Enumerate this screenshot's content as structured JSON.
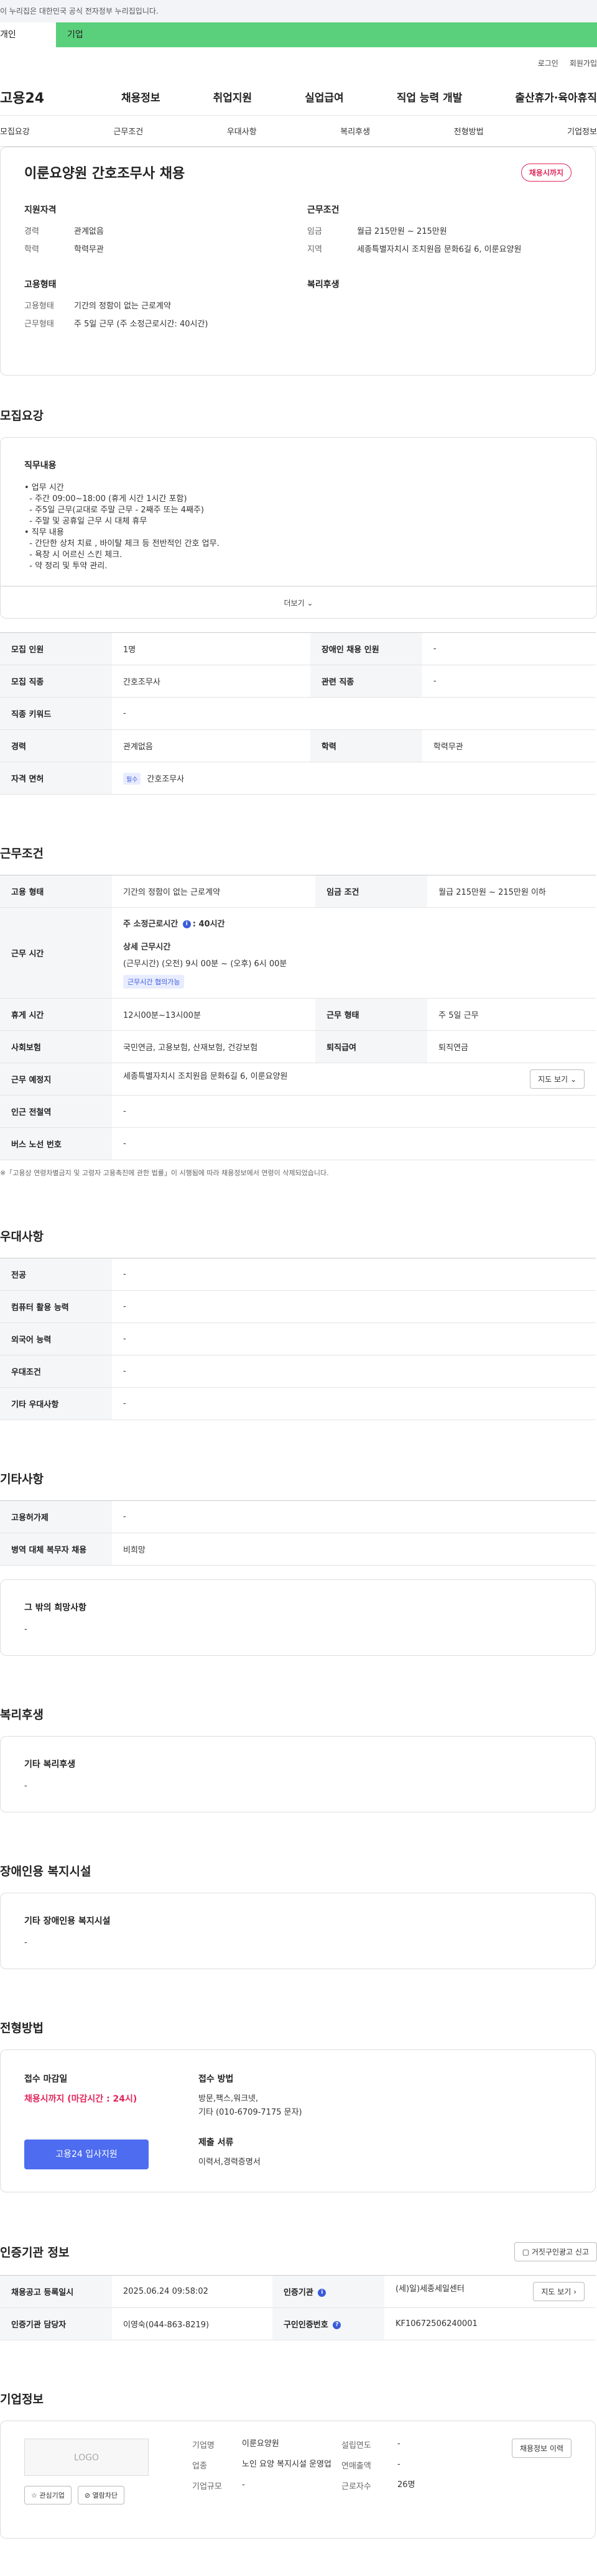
{
  "gov_banner": "이 누리집은 대한민국 공식 전자정부 누리집입니다.",
  "type_tabs": [
    "개인",
    "기업"
  ],
  "util": [
    "로그인",
    "회원가입"
  ],
  "logo": "고용24",
  "gnb": [
    "채용정보",
    "취업지원",
    "실업급여",
    "직업 능력 개발",
    "출산휴가·육아휴직"
  ],
  "section_tabs": [
    "모집요강",
    "근무조건",
    "우대사항",
    "복리후생",
    "전형방법",
    "기업정보"
  ],
  "summary": {
    "title": "이룬요양원 간호조무사 채용",
    "status": "채용시까지",
    "qual_heading": "지원자격",
    "career_key": "경력",
    "career_val": "관계없음",
    "edu_key": "학력",
    "edu_val": "학력무관",
    "cond_heading": "근무조건",
    "wage_key": "임금",
    "wage_val": "월급 215만원 ~ 215만원",
    "region_key": "지역",
    "region_val": "세종특별자치시 조치원읍 문화6길 6, 이룬요양원",
    "emp_heading": "고용형태",
    "emptype_key": "고용형태",
    "emptype_val": "기간의 정함이 없는 근로계약",
    "worktype_key": "근무형태",
    "worktype_val": "주 5일 근무 (주 소정근로시간: 40시간)",
    "welfare_heading": "복리후생"
  },
  "recruit": {
    "heading": "모집요강",
    "duty_heading": "직무내용",
    "duty_lines": [
      "• 업무 시간",
      "  - 주간 09:00~18:00 (휴게 시간 1시간 포함)",
      "  - 주5일 근무(교대로 주말 근무 - 2째주 또는 4째주)",
      "  - 주말 및 공휴일 근무 시 대체 휴무",
      "",
      "• 직무 내용",
      "  - 간단한 상처 치료 , 바이탈 체크 등 전반적인 간호 업무.",
      "  - 욕창 시 어르신 스킨 체크.",
      "  - 약 정리 및 투약 관리."
    ],
    "more": "더보기",
    "table": {
      "count_key": "모집 인원",
      "count_val": "1명",
      "disabled_key": "장애인 채용 인원",
      "disabled_val": "-",
      "job_key": "모집 직종",
      "job_val": "간호조무사",
      "related_key": "관련 직종",
      "related_val": "-",
      "keyword_key": "직종 키워드",
      "keyword_val": "-",
      "career_key": "경력",
      "career_val": "관계없음",
      "edu_key": "학력",
      "edu_val": "학력무관",
      "license_key": "자격 면허",
      "license_tag": "필수",
      "license_val": "간호조무사"
    }
  },
  "conditions": {
    "heading": "근무조건",
    "emptype_key": "고용 형태",
    "emptype_val": "기간의 정함이 없는 근로계약",
    "wage_key": "임금 조건",
    "wage_val": "월급 215만원 ~ 215만원 이하",
    "hours_key": "근무 시간",
    "hours_main": "주 소정근로시간",
    "hours_main_val": ": 40시간",
    "hours_detail_label": "상세 근무시간",
    "hours_detail": "(근무시간) (오전) 9시 00분 ~ (오후) 6시 00분",
    "hours_chip": "근무시간 협의가능",
    "break_key": "휴게 시간",
    "break_val": "12시00분~13시00분",
    "form_key": "근무 형태",
    "form_val": "주 5일 근무",
    "insurance_key": "사회보험",
    "insurance_val": "국민연금, 고용보험, 산재보험, 건강보험",
    "severance_key": "퇴직급여",
    "severance_val": "퇴직연금",
    "place_key": "근무 예정지",
    "place_val": "세종특별자치시 조치원읍 문화6길 6, 이룬요양원",
    "map_btn": "지도 보기",
    "subway_key": "인근 전철역",
    "subway_val": "-",
    "bus_key": "버스 노선 번호",
    "bus_val": "-",
    "note": "※「고용상 연령차별금지 및 고령자 고용촉진에 관한 법률」이 시행됨에 따라 채용정보에서 연령이 삭제되었습니다."
  },
  "preference": {
    "heading": "우대사항",
    "rows": [
      {
        "key": "전공",
        "val": "-"
      },
      {
        "key": "컴퓨터 활용 능력",
        "val": "-"
      },
      {
        "key": "외국어 능력",
        "val": "-"
      },
      {
        "key": "우대조건",
        "val": "-"
      },
      {
        "key": "기타 우대사항",
        "val": "-"
      }
    ]
  },
  "other": {
    "heading": "기타사항",
    "support_key": "고용허가제",
    "support_val": "-",
    "military_key": "병역 대체 복무자 채용",
    "military_val": "비희망",
    "wish_heading": "그 밖의 희망사항",
    "wish_val": "-"
  },
  "welfare": {
    "heading": "복리후생",
    "box_heading": "기타 복리후생",
    "box_val": "-"
  },
  "disability": {
    "heading": "장애인용 복지시설",
    "box_heading": "기타 장애인용 복지시설",
    "box_val": "-"
  },
  "selection": {
    "heading": "전형방법",
    "deadline_label": "접수 마감일",
    "deadline_val": "채용시까지 (마감시간 : 24시)",
    "apply_btn": "고용24 입사지원",
    "method_label": "접수 방법",
    "method_val1": "방문,팩스,워크넷,",
    "method_val2": "기타 (010-6709-7175 문자)",
    "docs_label": "제출 서류",
    "docs_val": "이력서,경력증명서"
  },
  "agency": {
    "heading": "인증기관 정보",
    "report_btn": "거짓구인광고 신고",
    "regdate_key": "채용공고 등록일시",
    "regdate_val": "2025.06.24 09:58:02",
    "agency_key": "인증기관",
    "agency_val": "(세)일)세종세일센터",
    "map_btn": "지도 보기",
    "manager_key": "인증기관 담당자",
    "manager_val": "이영숙(044-863-8219)",
    "jobno_key": "구인인증번호",
    "jobno_val": "KF10672506240001"
  },
  "company": {
    "heading": "기업정보",
    "logo_text": "LOGO",
    "fav_btn": "관심기업",
    "block_btn": "열람차단",
    "name_key": "기업명",
    "name_val": "이룬요양원",
    "industry_key": "업종",
    "industry_val": "노인 요양 복지시설 운영업",
    "size_key": "기업규모",
    "size_val": "-",
    "founded_key": "설립연도",
    "founded_val": "-",
    "sales_key": "연매출액",
    "sales_val": "-",
    "staff_key": "근로자수",
    "staff_val": "26명",
    "history_btn": "채용정보 이력"
  }
}
